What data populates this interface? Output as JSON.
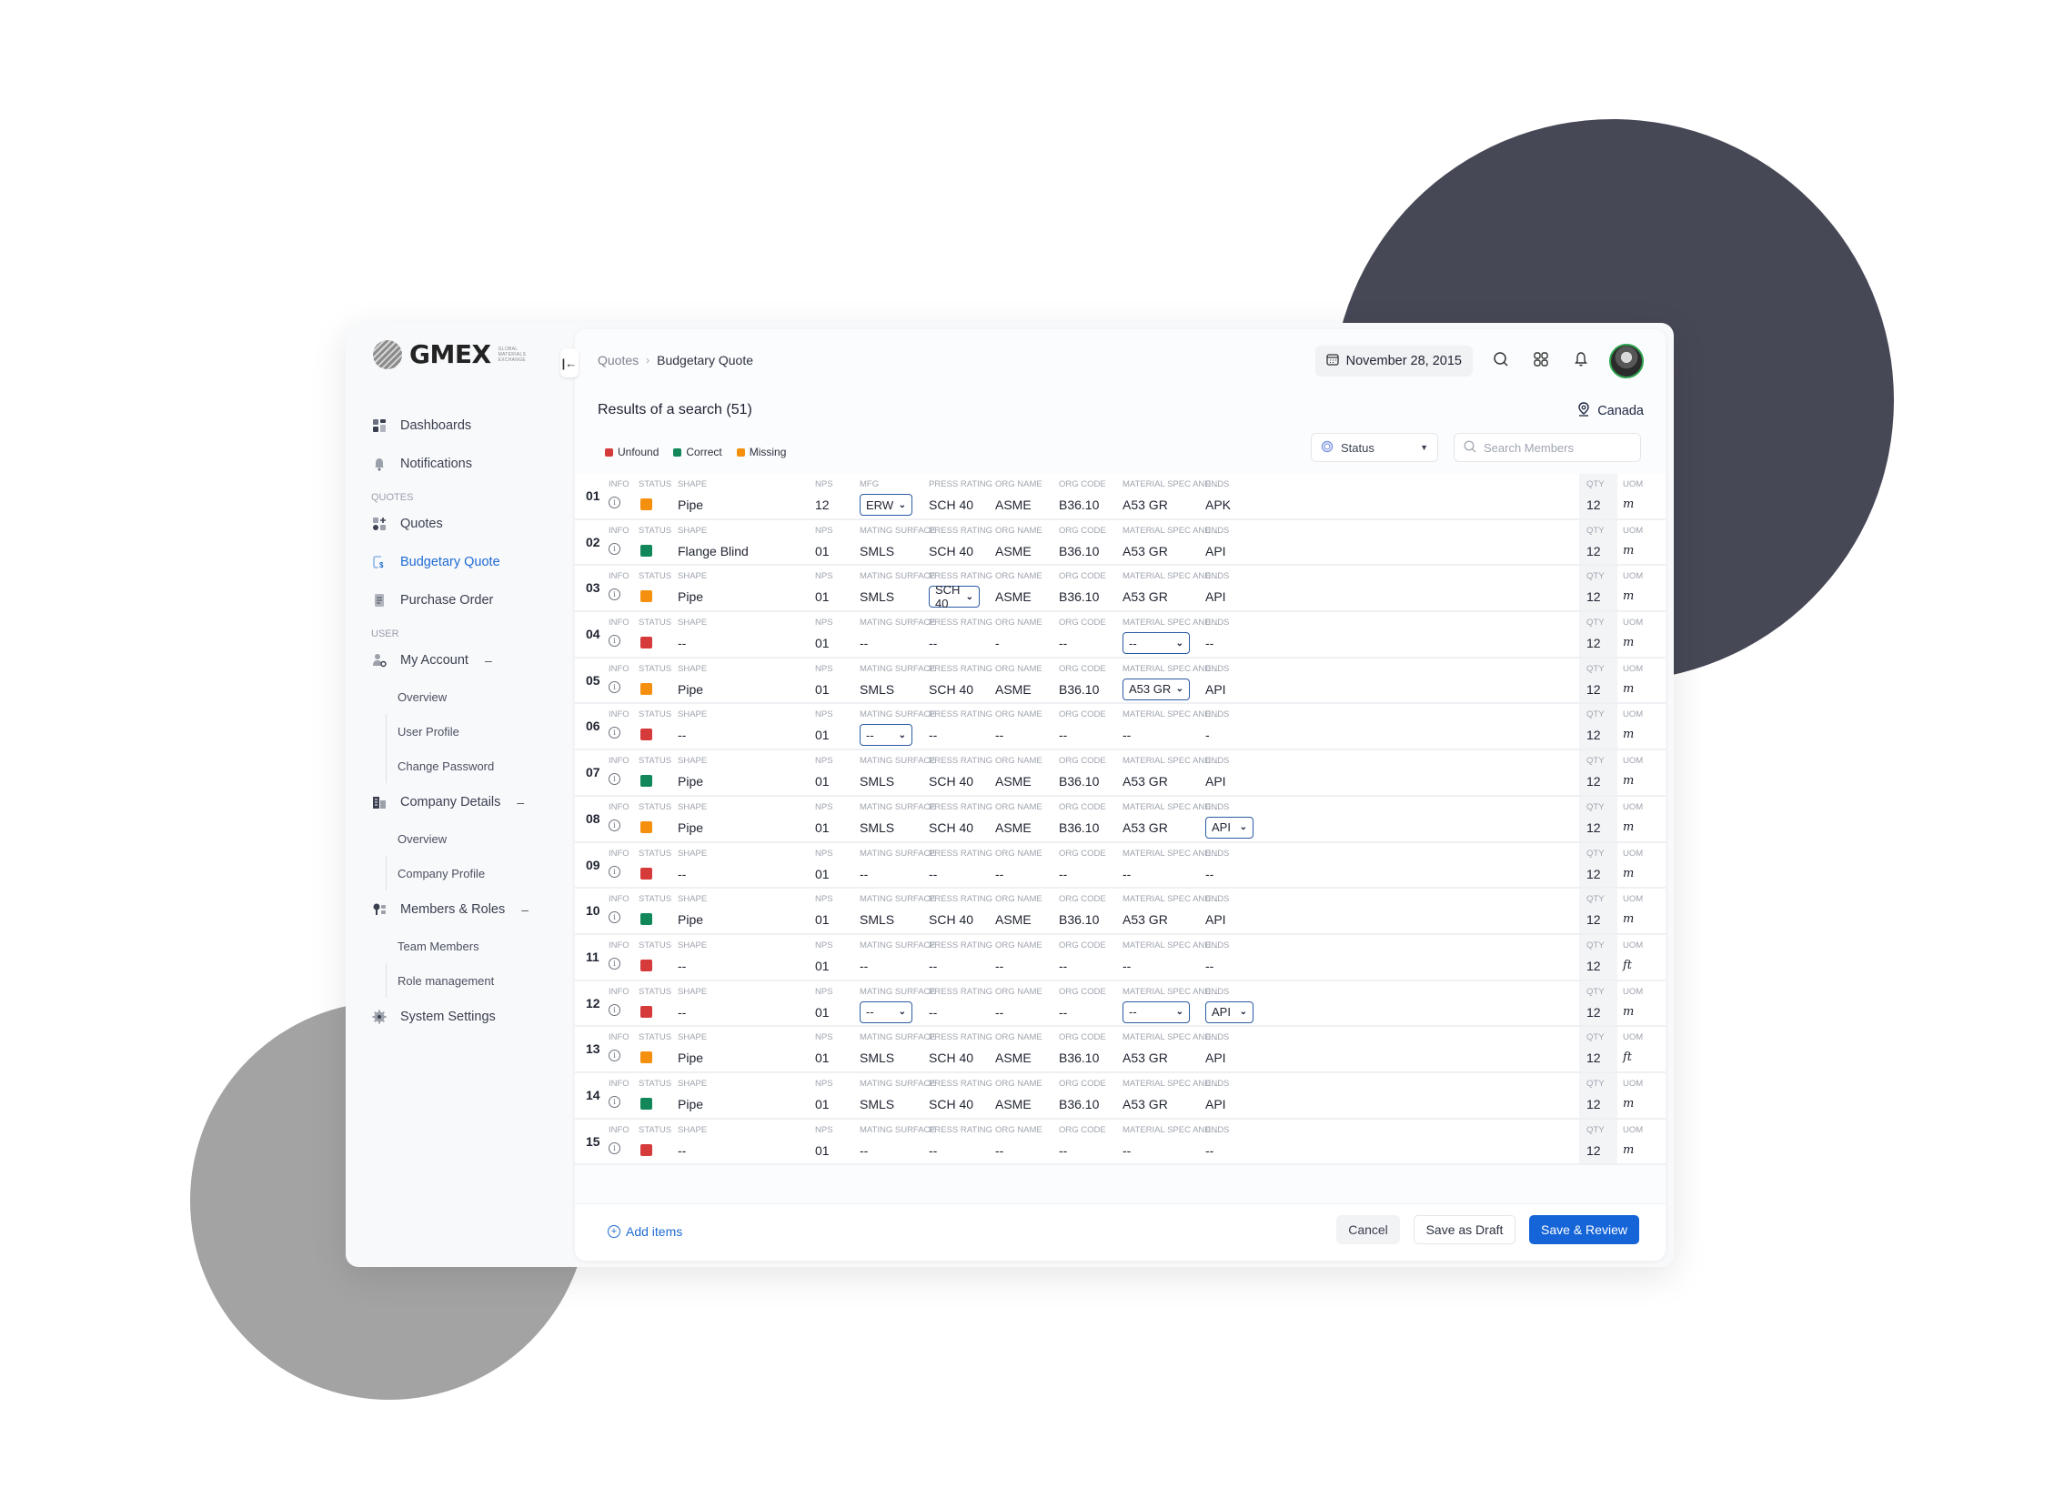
{
  "brand": {
    "name": "GMEX",
    "tagline": [
      "GLOBAL",
      "MATERIALS",
      "EXCHANGE"
    ]
  },
  "sidebar": {
    "collapse_icon": "collapse-left-icon",
    "items": [
      {
        "label": "Dashboards",
        "icon": "dashboard-icon",
        "active": false
      },
      {
        "label": "Notifications",
        "icon": "bell-icon",
        "active": false
      }
    ],
    "sections": [
      {
        "title": "QUOTES",
        "items": [
          {
            "label": "Quotes",
            "icon": "quotes-icon",
            "active": false
          },
          {
            "label": "Budgetary Quote",
            "icon": "budget-quote-icon",
            "active": true
          },
          {
            "label": "Purchase Order",
            "icon": "purchase-order-icon",
            "active": false
          }
        ]
      },
      {
        "title": "USER",
        "groups": [
          {
            "label": "My Account",
            "icon": "user-settings-icon",
            "expanded": true,
            "children": [
              "Overview",
              "User Profile",
              "Change Password"
            ]
          },
          {
            "label": "Company Details",
            "icon": "building-icon",
            "expanded": true,
            "children": [
              "Overview",
              "Company Profile"
            ]
          },
          {
            "label": "Members & Roles",
            "icon": "members-icon",
            "expanded": true,
            "children": [
              "Team Members",
              "Role management"
            ]
          }
        ],
        "after": {
          "label": "System Settings",
          "icon": "gear-icon"
        }
      }
    ]
  },
  "header": {
    "breadcrumb": [
      "Quotes",
      "Budgetary Quote"
    ],
    "date": "November 28, 2015",
    "icons": [
      "calendar-icon",
      "search-icon",
      "apps-grid-icon",
      "bell-icon",
      "avatar"
    ]
  },
  "results": {
    "title": "Results of a search (51)",
    "location": "Canada",
    "legend": [
      {
        "label": "Unfound",
        "color": "#d63b3b"
      },
      {
        "label": "Correct",
        "color": "#11875a"
      },
      {
        "label": "Missing",
        "color": "#f5900e"
      }
    ],
    "status_filter": {
      "label": "Status"
    },
    "search": {
      "placeholder": "Search Members",
      "value": ""
    }
  },
  "status_colors": {
    "unfound": "#d63b3b",
    "correct": "#11875a",
    "missing": "#f5900e"
  },
  "columns": {
    "info": "INFO",
    "status": "STATUS",
    "shape": "SHAPE",
    "nps": "NPS",
    "mfg": "MFG",
    "mating_surface": "MATING SURFACE",
    "press_rating": "PRESS RATING",
    "org_name": "ORG NAME",
    "org_code": "ORG CODE",
    "material_spec": "MATERIAL SPEC AND...",
    "ends": "ENDS",
    "qty": "QTY",
    "uom": "UOM"
  },
  "rows": [
    {
      "num": "01",
      "status": "missing",
      "shape": "Pipe",
      "nps": "12",
      "col5_label": "MFG",
      "col5": "ERW",
      "col5_dd": true,
      "press": "SCH 40",
      "press_dd": false,
      "org_name": "ASME",
      "org_code": "B36.10",
      "spec": "A53 GR",
      "spec_dd": false,
      "ends": "APK",
      "ends_dd": false,
      "qty": "12",
      "uom": "m"
    },
    {
      "num": "02",
      "status": "correct",
      "shape": "Flange Blind",
      "nps": "01",
      "col5_label": "MATING SURFACE",
      "col5": "SMLS",
      "col5_dd": false,
      "press": "SCH 40",
      "press_dd": false,
      "org_name": "ASME",
      "org_code": "B36.10",
      "spec": "A53 GR",
      "spec_dd": false,
      "ends": "API",
      "ends_dd": false,
      "qty": "12",
      "uom": "m"
    },
    {
      "num": "03",
      "status": "missing",
      "shape": "Pipe",
      "nps": "01",
      "col5_label": "MATING SURFACE",
      "col5": "SMLS",
      "col5_dd": false,
      "press": "SCH 40",
      "press_dd": true,
      "org_name": "ASME",
      "org_code": "B36.10",
      "spec": "A53 GR",
      "spec_dd": false,
      "ends": "API",
      "ends_dd": false,
      "qty": "12",
      "uom": "m"
    },
    {
      "num": "04",
      "status": "unfound",
      "shape": "--",
      "nps": "01",
      "col5_label": "MATING SURFACE",
      "col5": "--",
      "col5_dd": false,
      "press": "--",
      "press_dd": false,
      "org_name": "-",
      "org_code": "--",
      "spec": "--",
      "spec_dd": true,
      "ends": "--",
      "ends_dd": false,
      "qty": "12",
      "uom": "m"
    },
    {
      "num": "05",
      "status": "missing",
      "shape": "Pipe",
      "nps": "01",
      "col5_label": "MATING SURFACE",
      "col5": "SMLS",
      "col5_dd": false,
      "press": "SCH 40",
      "press_dd": false,
      "org_name": "ASME",
      "org_code": "B36.10",
      "spec": "A53 GR",
      "spec_dd": true,
      "ends": "API",
      "ends_dd": false,
      "qty": "12",
      "uom": "m"
    },
    {
      "num": "06",
      "status": "unfound",
      "shape": "--",
      "nps": "01",
      "col5_label": "MATING SURFACE",
      "col5": "--",
      "col5_dd": true,
      "press": "--",
      "press_dd": false,
      "org_name": "--",
      "org_code": "--",
      "spec": "--",
      "spec_dd": false,
      "ends": "-",
      "ends_dd": false,
      "qty": "12",
      "uom": "m"
    },
    {
      "num": "07",
      "status": "correct",
      "shape": "Pipe",
      "nps": "01",
      "col5_label": "MATING SURFACE",
      "col5": "SMLS",
      "col5_dd": false,
      "press": "SCH 40",
      "press_dd": false,
      "org_name": "ASME",
      "org_code": "B36.10",
      "spec": "A53 GR",
      "spec_dd": false,
      "ends": "API",
      "ends_dd": false,
      "qty": "12",
      "uom": "m"
    },
    {
      "num": "08",
      "status": "missing",
      "shape": "Pipe",
      "nps": "01",
      "col5_label": "MATING SURFACE",
      "col5": "SMLS",
      "col5_dd": false,
      "press": "SCH 40",
      "press_dd": false,
      "org_name": "ASME",
      "org_code": "B36.10",
      "spec": "A53 GR",
      "spec_dd": false,
      "ends": "API",
      "ends_dd": true,
      "qty": "12",
      "uom": "m"
    },
    {
      "num": "09",
      "status": "unfound",
      "shape": "--",
      "nps": "01",
      "col5_label": "MATING SURFACE",
      "col5": "--",
      "col5_dd": false,
      "press": "--",
      "press_dd": false,
      "org_name": "--",
      "org_code": "--",
      "spec": "--",
      "spec_dd": false,
      "ends": "--",
      "ends_dd": false,
      "qty": "12",
      "uom": "m"
    },
    {
      "num": "10",
      "status": "correct",
      "shape": "Pipe",
      "nps": "01",
      "col5_label": "MATING SURFACE",
      "col5": "SMLS",
      "col5_dd": false,
      "press": "SCH 40",
      "press_dd": false,
      "org_name": "ASME",
      "org_code": "B36.10",
      "spec": "A53 GR",
      "spec_dd": false,
      "ends": "API",
      "ends_dd": false,
      "qty": "12",
      "uom": "m"
    },
    {
      "num": "11",
      "status": "unfound",
      "shape": "--",
      "nps": "01",
      "col5_label": "MATING SURFACE",
      "col5": "--",
      "col5_dd": false,
      "press": "--",
      "press_dd": false,
      "org_name": "--",
      "org_code": "--",
      "spec": "--",
      "spec_dd": false,
      "ends": "--",
      "ends_dd": false,
      "qty": "12",
      "uom": "ft"
    },
    {
      "num": "12",
      "status": "unfound",
      "shape": "--",
      "nps": "01",
      "col5_label": "MATING SURFACE",
      "col5": "--",
      "col5_dd": true,
      "press": "--",
      "press_dd": false,
      "org_name": "--",
      "org_code": "--",
      "spec": "--",
      "spec_dd": true,
      "ends": "API",
      "ends_dd": true,
      "qty": "12",
      "uom": "m"
    },
    {
      "num": "13",
      "status": "missing",
      "shape": "Pipe",
      "nps": "01",
      "col5_label": "MATING SURFACE",
      "col5": "SMLS",
      "col5_dd": false,
      "press": "SCH 40",
      "press_dd": false,
      "org_name": "ASME",
      "org_code": "B36.10",
      "spec": "A53 GR",
      "spec_dd": false,
      "ends": "API",
      "ends_dd": false,
      "qty": "12",
      "uom": "ft"
    },
    {
      "num": "14",
      "status": "correct",
      "shape": "Pipe",
      "nps": "01",
      "col5_label": "MATING SURFACE",
      "col5": "SMLS",
      "col5_dd": false,
      "press": "SCH 40",
      "press_dd": false,
      "org_name": "ASME",
      "org_code": "B36.10",
      "spec": "A53 GR",
      "spec_dd": false,
      "ends": "API",
      "ends_dd": false,
      "qty": "12",
      "uom": "m"
    },
    {
      "num": "15",
      "status": "unfound",
      "shape": "--",
      "nps": "01",
      "col5_label": "MATING SURFACE",
      "col5": "--",
      "col5_dd": false,
      "press": "--",
      "press_dd": false,
      "org_name": "--",
      "org_code": "--",
      "spec": "--",
      "spec_dd": false,
      "ends": "--",
      "ends_dd": false,
      "qty": "12",
      "uom": "m"
    }
  ],
  "footer": {
    "add_items": "Add items",
    "cancel": "Cancel",
    "save_draft": "Save as Draft",
    "save_review": "Save & Review"
  }
}
